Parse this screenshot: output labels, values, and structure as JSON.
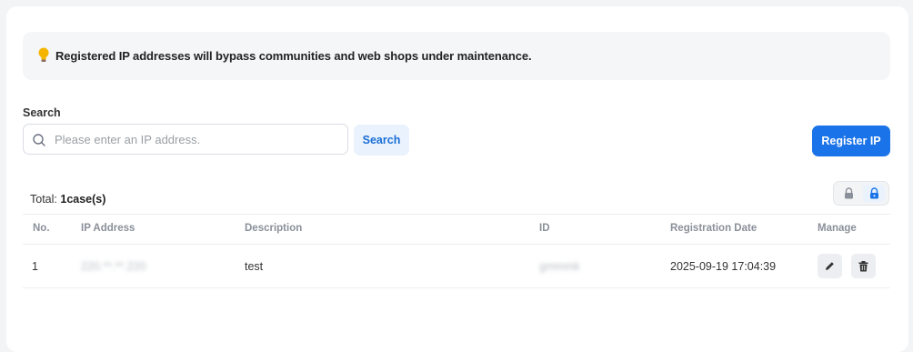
{
  "notice": {
    "icon": "lightbulb-icon",
    "text": "Registered IP addresses will bypass communities and web shops under maintenance."
  },
  "search": {
    "label": "Search",
    "placeholder": "Please enter an IP address.",
    "value": "",
    "button_label": "Search"
  },
  "register_button": "Register IP",
  "total": {
    "label": "Total:",
    "count": "1case(s)"
  },
  "lock_toggle": {
    "options": [
      "lock-icon",
      "lock-icon"
    ],
    "active_index": 1
  },
  "table": {
    "columns": [
      "No.",
      "IP Address",
      "Description",
      "ID",
      "Registration Date",
      "Manage"
    ],
    "rows": [
      {
        "no": "1",
        "ip": "220.**.**.220",
        "description": "test",
        "id": "gmmmk",
        "date": "2025-09-19 17:04:39"
      }
    ]
  },
  "colors": {
    "accent": "#1a73e8",
    "accent_light": "#eaf2fd",
    "notice_bg": "#f5f6f8"
  }
}
